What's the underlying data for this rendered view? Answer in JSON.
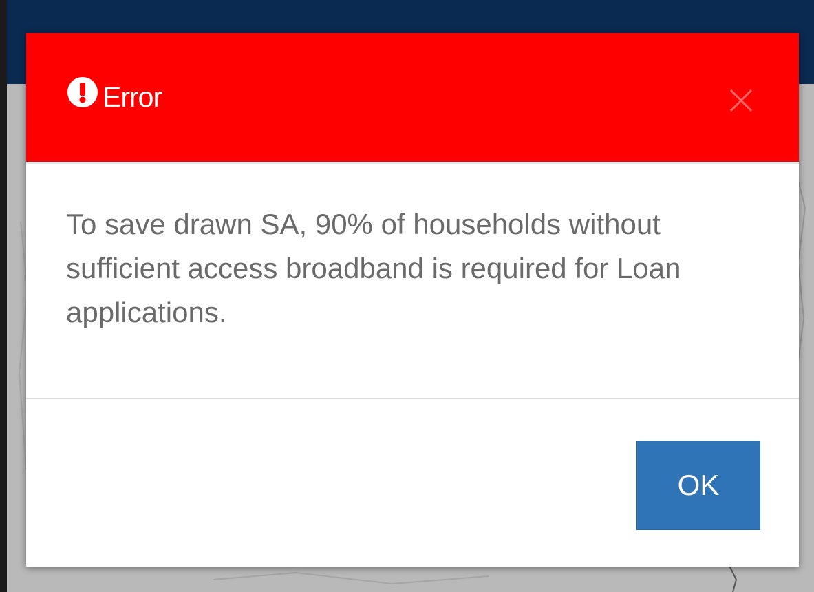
{
  "dialog": {
    "title": "Error",
    "header_icon": "exclamation-circle-icon",
    "close_icon": "close-icon",
    "message": "To save drawn SA, 90% of households without sufficient access broadband is required for Loan applications.",
    "ok_label": "OK"
  },
  "colors": {
    "header_bg": "#fe0000",
    "ok_button_bg": "#2f74b7",
    "topbar_bg": "#0a2a52",
    "message_text": "#6a6a6a"
  }
}
